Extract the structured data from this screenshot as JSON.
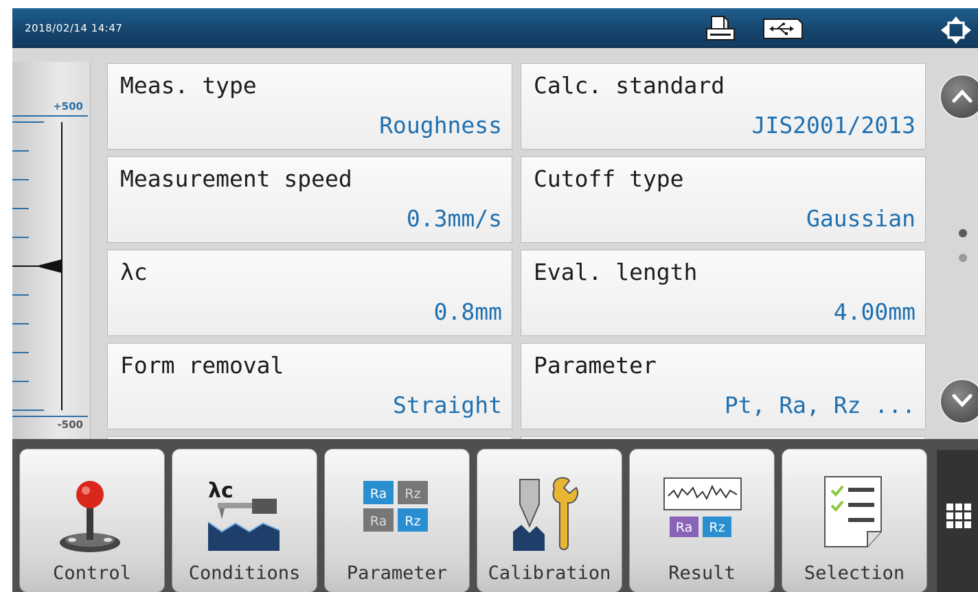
{
  "header": {
    "datetime": "2018/02/14 14:47",
    "icons": [
      "printer-icon",
      "usb-icon",
      "move-arrows-icon"
    ]
  },
  "gauge": {
    "top_label": "+500",
    "bottom_label": "-500"
  },
  "conditions": [
    {
      "label": "Meas. type",
      "value": "Roughness"
    },
    {
      "label": "Calc. standard",
      "value": "JIS2001/2013"
    },
    {
      "label": "Measurement speed",
      "value": "0.3mm/s"
    },
    {
      "label": "Cutoff type",
      "value": "Gaussian"
    },
    {
      "label": "λc",
      "value": "0.8mm"
    },
    {
      "label": "Eval. length",
      "value": "4.00mm"
    },
    {
      "label": "Form removal",
      "value": "Straight"
    },
    {
      "label": "Parameter",
      "value": "Pt, Ra, Rz ..."
    }
  ],
  "pager": {
    "page_count": 2,
    "current_page": 1
  },
  "toolbar": {
    "buttons": [
      {
        "label": "Control",
        "icon": "joystick-icon"
      },
      {
        "label": "Conditions",
        "icon": "stylus-conditions-icon"
      },
      {
        "label": "Parameter",
        "icon": "parameter-tiles-icon"
      },
      {
        "label": "Calibration",
        "icon": "calibration-tool-icon"
      },
      {
        "label": "Result",
        "icon": "result-graph-icon"
      },
      {
        "label": "Selection",
        "icon": "checklist-icon"
      }
    ],
    "icon_text": {
      "conditions_lambda": "λc",
      "ra": "Ra",
      "rz": "Rz"
    }
  },
  "colors": {
    "header_bg": "#16466d",
    "value_text": "#1f70b0",
    "tile_blue": "#2a8fd0",
    "tile_gray": "#777777",
    "tile_purple": "#8a62b8"
  }
}
